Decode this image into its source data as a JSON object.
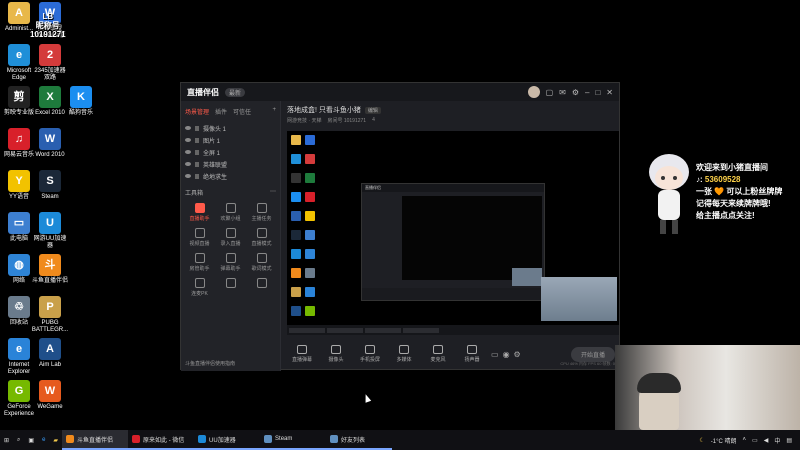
{
  "desktop": {
    "icons": [
      {
        "label": "Administ...",
        "color": "#e8b84a",
        "glyph": "A"
      },
      {
        "label": "英雄联盟\nWeGame版",
        "color": "#2b6bd6",
        "glyph": "W"
      },
      {
        "label": "Microsoft\nEdge",
        "color": "#1f8fd8",
        "glyph": "e"
      },
      {
        "label": "2345加速器\n双路",
        "color": "#d43b3b",
        "glyph": "2"
      },
      {
        "label": "剪映专业版",
        "color": "#222222",
        "glyph": "剪"
      },
      {
        "label": "Excel 2010",
        "color": "#1e7b3c",
        "glyph": "X"
      },
      {
        "label": "酷狗音乐",
        "color": "#1b8ef0",
        "glyph": "K"
      },
      {
        "label": "网易云音乐",
        "color": "#d8202a",
        "glyph": "♫"
      },
      {
        "label": "Word 2010",
        "color": "#2a5fb0",
        "glyph": "W"
      },
      {
        "label": "YY语音",
        "color": "#f2c200",
        "glyph": "Y"
      },
      {
        "label": "Steam",
        "color": "#1b2838",
        "glyph": "S"
      },
      {
        "label": "此电脑",
        "color": "#3d7fd0",
        "glyph": "▭"
      },
      {
        "label": "网游UU加速\n器",
        "color": "#1c8ad8",
        "glyph": "U"
      },
      {
        "label": "网络",
        "color": "#2e84d6",
        "glyph": "◍"
      },
      {
        "label": "斗鱼直播伴侣",
        "color": "#f08a1c",
        "glyph": "斗"
      },
      {
        "label": "回收站",
        "color": "#6a7b8c",
        "glyph": "♲"
      },
      {
        "label": "PUBG\nBATTLEGR...",
        "color": "#c9a04a",
        "glyph": "P"
      },
      {
        "label": "Internet\nExplorer",
        "color": "#2a83d8",
        "glyph": "e"
      },
      {
        "label": "Aim Lab",
        "color": "#1f4f8a",
        "glyph": "A"
      },
      {
        "label": "GeForce\nExperience",
        "color": "#76b900",
        "glyph": "G"
      },
      {
        "label": "WeGame",
        "color": "#e65a1e",
        "glyph": "W"
      }
    ],
    "watermark": "LB\n昵称号\n10191271"
  },
  "window": {
    "app_name": "直播伴侣",
    "version_badge": "最新",
    "left_tabs": [
      "场景管理",
      "插件",
      "可信任",
      "+"
    ],
    "scenes": [
      "摄像头 1",
      "图片 1",
      "全屏 1",
      "英雄联盟",
      "绝地求生"
    ],
    "tools_title": "工具箱",
    "tools": [
      {
        "label": "直播助手",
        "hot": true
      },
      {
        "label": "欢聚小组",
        "hot": false
      },
      {
        "label": "主播任务",
        "hot": false
      },
      {
        "label": "视频直播",
        "hot": false
      },
      {
        "label": "录入直播",
        "hot": false
      },
      {
        "label": "直播模式",
        "hot": false
      },
      {
        "label": "房管助手",
        "hot": false
      },
      {
        "label": "弹幕助手",
        "hot": false
      },
      {
        "label": "歌词模式",
        "hot": false
      },
      {
        "label": "连麦PK",
        "hot": false
      },
      {
        "label": "",
        "hot": false
      },
      {
        "label": "",
        "hot": false
      }
    ],
    "notice": "斗鱼直播伴侣使用指南",
    "room_title": "落地成盒! 只看斗鱼小猪",
    "room_edit": "编辑",
    "room_meta": [
      "网游竞技 · 天梯",
      "房间号 10191271",
      "4"
    ],
    "bottom_buttons": [
      "直播弹幕",
      "摄像头",
      "手机投屏",
      "多媒体",
      "麦克风",
      "扬声器"
    ],
    "start_button": "开始直播",
    "status": "CPU 46% 内存 FPS 60 帧数: 0"
  },
  "overlay": {
    "line1": "欢迎来到小猪直播间",
    "line2_prefix": "♪:",
    "line2_num": "53609528",
    "line3": "一张 🧡 可以上粉丝牌牌",
    "line4": "记得每天来续牌牌哦!",
    "line5": "给主播点点关注!"
  },
  "taskbar": {
    "apps": [
      {
        "label": "斗鱼直播伴侣",
        "color": "#f08a1c",
        "active": true
      },
      {
        "label": "原来如此 - 微信",
        "color": "#d8202a",
        "active": false
      },
      {
        "label": "UU加速器",
        "color": "#1c8ad8",
        "active": false
      },
      {
        "label": "Steam",
        "color": "#5f8fbf",
        "active": false
      },
      {
        "label": "好友列表",
        "color": "#5f8fbf",
        "active": false
      }
    ],
    "weather": "-1°C 晴朗",
    "lang": "中"
  }
}
